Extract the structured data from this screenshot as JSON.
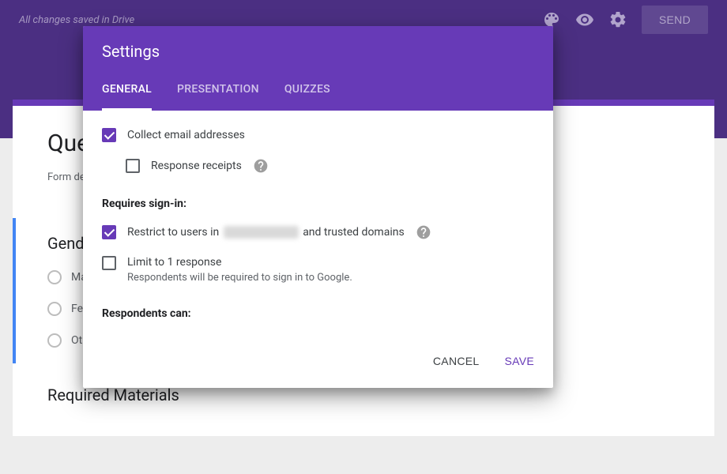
{
  "topbar": {
    "save_status": "All changes saved in Drive",
    "send_label": "SEND"
  },
  "background_form": {
    "title_visible": "Que",
    "description_label": "Form de",
    "question1_title": "Gend",
    "option1": "Ma",
    "option2": "Fer",
    "option3": "Oth",
    "section2_title": "Required Materials"
  },
  "modal": {
    "title": "Settings",
    "tabs": {
      "general": "GENERAL",
      "presentation": "PRESENTATION",
      "quizzes": "QUIZZES"
    },
    "collect_email_label": "Collect email addresses",
    "response_receipts_label": "Response receipts",
    "requires_signin_label": "Requires sign-in:",
    "restrict_prefix": "Restrict to users in ",
    "restrict_suffix": " and trusted domains",
    "limit_label": "Limit to 1 response",
    "limit_subtext": "Respondents will be required to sign in to Google.",
    "respondents_can_label": "Respondents can:",
    "actions": {
      "cancel": "CANCEL",
      "save": "SAVE"
    }
  }
}
